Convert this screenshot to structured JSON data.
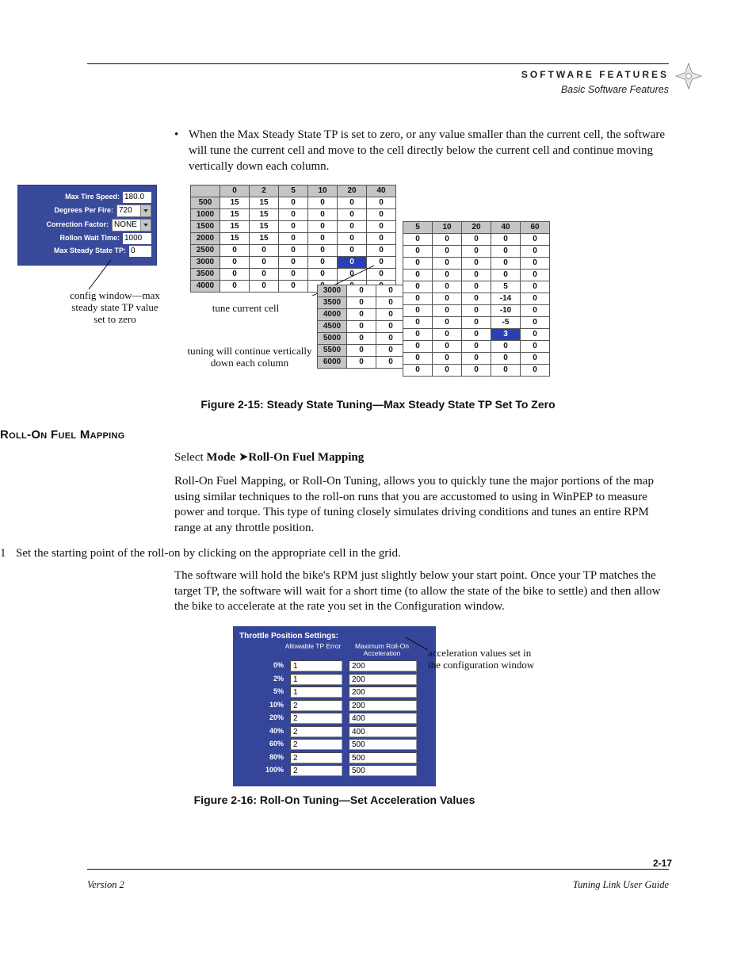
{
  "header": {
    "title": "SOFTWARE FEATURES",
    "subtitle": "Basic Software Features"
  },
  "bullet_text": "When the Max Steady State TP is set to zero, or any value smaller than the current cell, the software will tune the current cell and move to the cell directly below the current cell and continue moving vertically down each column.",
  "config": {
    "max_tire_speed": {
      "label": "Max Tire Speed:",
      "value": "180.0"
    },
    "degrees_per_fire": {
      "label": "Degrees Per Fire:",
      "value": "720"
    },
    "correction_factor": {
      "label": "Correction Factor:",
      "value": "NONE"
    },
    "rollon_wait_time": {
      "label": "Rollon Wait Time:",
      "value": "1000"
    },
    "max_steady_state_tp": {
      "label": "Max Steady State TP:",
      "value": "0"
    }
  },
  "callouts": {
    "config": "config window—max\nsteady state TP value\nset to zero",
    "tune": "tune current cell",
    "vertical": "tuning will continue vertically\ndown each column",
    "accel": "acceleration values set in\nthe configuration window"
  },
  "grid1": {
    "cols": [
      "0",
      "2",
      "5",
      "10",
      "20",
      "40"
    ],
    "rows": [
      "500",
      "1000",
      "1500",
      "2000",
      "2500",
      "3000",
      "3500",
      "4000"
    ],
    "cells": [
      [
        "15",
        "15",
        "0",
        "0",
        "0",
        "0"
      ],
      [
        "15",
        "15",
        "0",
        "0",
        "0",
        "0"
      ],
      [
        "15",
        "15",
        "0",
        "0",
        "0",
        "0"
      ],
      [
        "15",
        "15",
        "0",
        "0",
        "0",
        "0"
      ],
      [
        "0",
        "0",
        "0",
        "0",
        "0",
        "0"
      ],
      [
        "0",
        "0",
        "0",
        "0",
        "0",
        "0"
      ],
      [
        "0",
        "0",
        "0",
        "0",
        "0",
        "0"
      ],
      [
        "0",
        "0",
        "0",
        "0",
        "0",
        "0"
      ]
    ],
    "sel": "0"
  },
  "grid2": {
    "cols": [
      "5",
      "10",
      "20",
      "40",
      "60"
    ],
    "rows": [
      "",
      "",
      "",
      "",
      "3000",
      "3500",
      "4000",
      "4500",
      "5000",
      "5500",
      "6000",
      ""
    ],
    "cells": [
      [
        "0",
        "0",
        "0",
        "0",
        "0"
      ],
      [
        "0",
        "0",
        "0",
        "0",
        "0"
      ],
      [
        "0",
        "0",
        "0",
        "0",
        "0"
      ],
      [
        "0",
        "0",
        "0",
        "0",
        "0"
      ],
      [
        "0",
        "0",
        "0",
        "5",
        "0"
      ],
      [
        "0",
        "0",
        "0",
        "-14",
        "0"
      ],
      [
        "0",
        "0",
        "0",
        "-10",
        "0"
      ],
      [
        "0",
        "0",
        "0",
        "-5",
        "0"
      ],
      [
        "0",
        "0",
        "0",
        "3",
        "0"
      ],
      [
        "0",
        "0",
        "0",
        "0",
        "0"
      ],
      [
        "0",
        "0",
        "0",
        "0",
        "0"
      ],
      [
        "0",
        "0",
        "0",
        "0",
        "0"
      ]
    ],
    "sel": "3"
  },
  "fig1_caption": "Figure 2-15: Steady State Tuning—Max Steady State TP Set To Zero",
  "section_title": "Roll-On Fuel Mapping",
  "select_line": {
    "prefix": "Select ",
    "mode": "Mode",
    "item": "Roll-On Fuel Mapping"
  },
  "para1": "Roll-On Fuel Mapping, or Roll-On Tuning, allows you to quickly tune the major portions of the map using similar techniques to the roll-on runs that you are accustomed to using in WinPEP to measure power and torque. This type of tuning closely simulates driving conditions and tunes an entire RPM range at any throttle position.",
  "step1": {
    "num": "1",
    "text": "Set the starting point of the roll-on by clicking on the appropriate cell in the grid."
  },
  "para2": "The software will hold the bike's RPM just slightly below your start point. Once your TP matches the target TP, the software will wait for a short time (to allow the state of the bike to settle) and then allow the bike to accelerate at the rate you set in the Configuration window.",
  "tp": {
    "title": "Throttle Position Settings:",
    "head1": "Allowable TP Error",
    "head2": "Maximum Roll-On Acceleration",
    "rows": [
      {
        "tp": "0%",
        "err": "1",
        "acc": "200"
      },
      {
        "tp": "2%",
        "err": "1",
        "acc": "200"
      },
      {
        "tp": "5%",
        "err": "1",
        "acc": "200"
      },
      {
        "tp": "10%",
        "err": "2",
        "acc": "200"
      },
      {
        "tp": "20%",
        "err": "2",
        "acc": "400"
      },
      {
        "tp": "40%",
        "err": "2",
        "acc": "400"
      },
      {
        "tp": "60%",
        "err": "2",
        "acc": "500"
      },
      {
        "tp": "80%",
        "err": "2",
        "acc": "500"
      },
      {
        "tp": "100%",
        "err": "2",
        "acc": "500"
      }
    ]
  },
  "fig2_caption": "Figure 2-16: Roll-On Tuning—Set Acceleration Values",
  "footer": {
    "left": "Version 2",
    "right": "Tuning Link User Guide",
    "page": "2-17"
  }
}
